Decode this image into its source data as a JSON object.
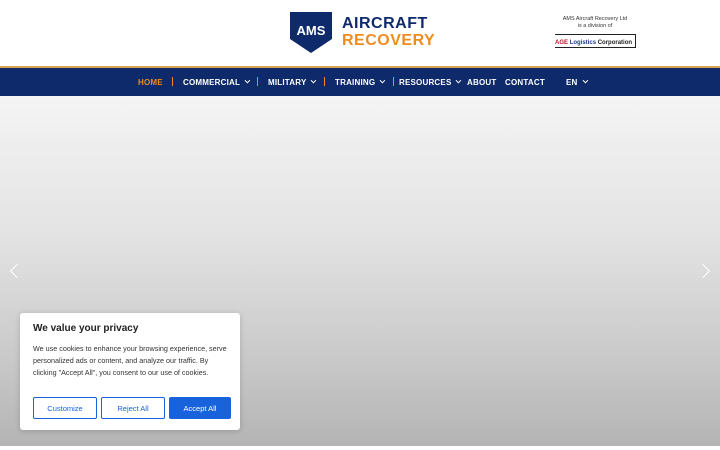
{
  "header": {
    "logo": {
      "badge_text": "AMS",
      "line1": "AIRCRAFT",
      "line2": "RECOVERY",
      "colors": {
        "navy": "#0f2a6b",
        "orange": "#f08c1c"
      }
    },
    "division": {
      "line1": "AMS Aircraft Recovery Ltd",
      "line2": "is a division of",
      "corp_age": "AGE",
      "corp_logistics": "Logistics",
      "corp_suffix": "Corporation"
    }
  },
  "nav": {
    "items": [
      {
        "label": "HOME",
        "active": true
      },
      {
        "label": "COMMERCIAL",
        "dropdown": true
      },
      {
        "label": "MILITARY",
        "dropdown": true
      },
      {
        "label": "TRAINING",
        "dropdown": true
      },
      {
        "label": "RESOURCES",
        "dropdown": true
      },
      {
        "label": "ABOUT"
      },
      {
        "label": "CONTACT"
      },
      {
        "label": "EN",
        "dropdown": true
      }
    ],
    "colors": {
      "background": "#0f2a6b",
      "active": "#f08c1c",
      "separator": "#f08c1c"
    }
  },
  "hero": {
    "prev_icon": "chevron-left-icon",
    "next_icon": "chevron-right-icon"
  },
  "cookie": {
    "title": "We value your privacy",
    "body": "We use cookies to enhance your browsing experience, serve personalized ads or content, and analyze our traffic. By clicking \"Accept All\", you consent to our use of cookies.",
    "customize_label": "Customize",
    "reject_label": "Reject All",
    "accept_label": "Accept All",
    "accent": "#1863dc"
  }
}
